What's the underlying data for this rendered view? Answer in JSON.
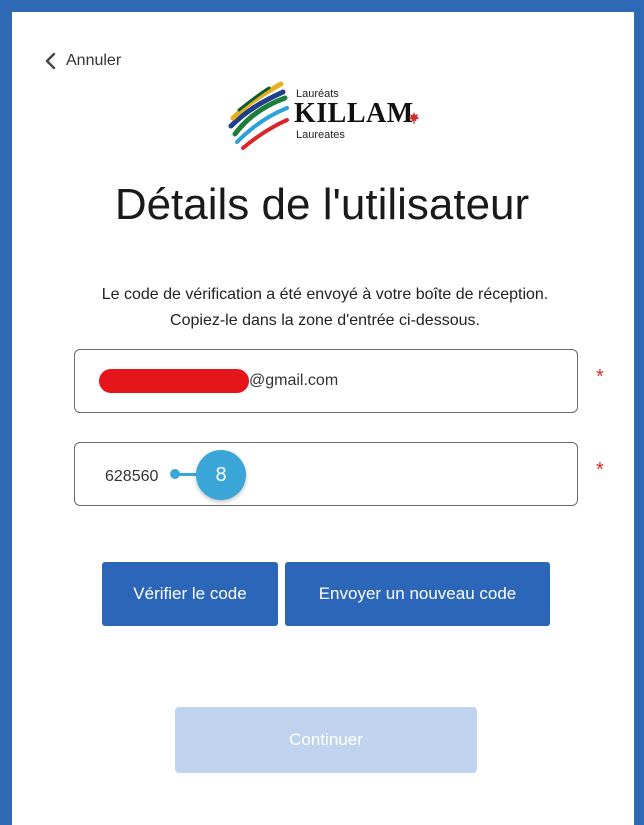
{
  "nav": {
    "cancel_label": "Annuler"
  },
  "logo": {
    "line1": "Lauréats",
    "line2": "KILLAM",
    "line3": "Laureates"
  },
  "page": {
    "title": "Détails de l'utilisateur",
    "description": "Le code de vérification a été envoyé à votre boîte de réception. Copiez-le dans la zone d'entrée ci-dessous."
  },
  "form": {
    "email_suffix": "@gmail.com",
    "code_value": "628560",
    "required_mark": "*",
    "step_number": "8"
  },
  "buttons": {
    "verify_label": "Vérifier le code",
    "resend_label": "Envoyer un nouveau code",
    "continue_label": "Continuer"
  },
  "colors": {
    "primary": "#2b66b8",
    "disabled": "#bfd2ee",
    "required": "#d62c2c",
    "annotation": "#3aa6d8",
    "redaction": "#e4161b"
  }
}
